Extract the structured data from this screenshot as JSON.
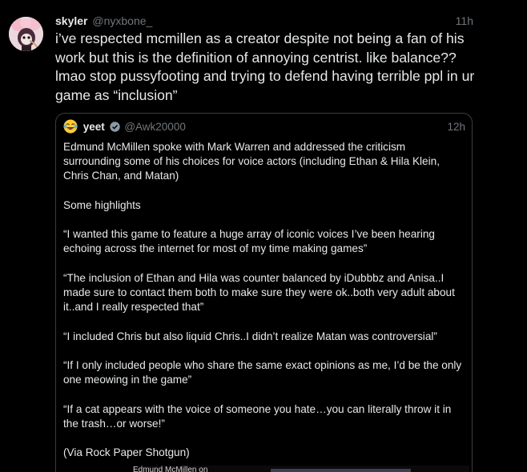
{
  "tweet": {
    "display_name": "skyler",
    "handle": "@nyxbone_",
    "time": "11h",
    "text": "i’ve respected mcmillen as a creator despite not being a fan of his work but this is the definition of annoying centrist. like balance?? lmao stop pussyfooting and trying to defend having terrible ppl in ur game as “inclusion”"
  },
  "quote": {
    "emoji_icon": "laughing-tears-emoji-icon",
    "display_name": "yeet",
    "verified_icon": "verified-badge-icon",
    "handle": "@Awk20000",
    "time": "12h",
    "paragraphs": [
      "Edmund McMillen spoke with Mark Warren and addressed the criticism surrounding some of his choices for voice actors (including Ethan & Hila Klein, Chris Chan, and Matan)",
      "Some highlights",
      "“I wanted this game to feature a huge array of iconic voices I’ve been hearing echoing across the internet for most of my time making games”",
      "“The inclusion of Ethan and Hila was counter balanced by iDubbbz and Anisa..I made sure to contact them both to make sure they were ok..both very adult about it..and I really respected that”",
      "“I included Chris but also liquid Chris..I didn’t realize Matan was controversial”",
      "“If I only included people who share the same exact opinions as me, I’d be the only one meowing in the game”",
      "“If a cat appears with the voice of someone you hate…you can literally throw it in the trash…or worse!”",
      "(Via Rock Paper Shotgun)"
    ],
    "media_caption": "Edmund McMillen on"
  },
  "colors": {
    "background": "#000000",
    "text_primary": "#e7e9ea",
    "text_secondary": "#71767b",
    "border": "#3a3d42",
    "verified": "#1d9bf0"
  }
}
